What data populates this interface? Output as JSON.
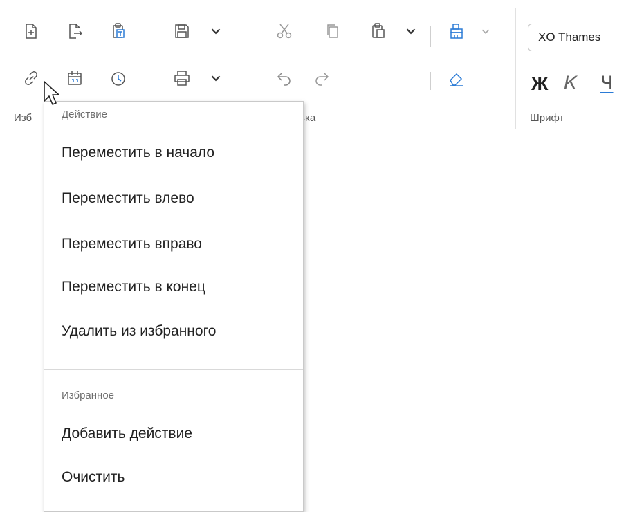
{
  "ribbon": {
    "groups": {
      "favorites_label": "Изб",
      "clipboard_label": "вка",
      "font_label": "Шрифт"
    },
    "font_name": "XO Thames",
    "format": {
      "bold": "Ж",
      "italic": "К",
      "underline": "Ч"
    },
    "accent_color": "#2b7bd6"
  },
  "context_menu": {
    "section_action_header": "Действие",
    "items_action": [
      "Переместить в начало",
      "Переместить влево",
      "Переместить вправо",
      "Переместить в конец",
      "Удалить из избранного"
    ],
    "section_favorites_header": "Избранное",
    "items_favorites": [
      "Добавить действие",
      "Очистить"
    ]
  }
}
